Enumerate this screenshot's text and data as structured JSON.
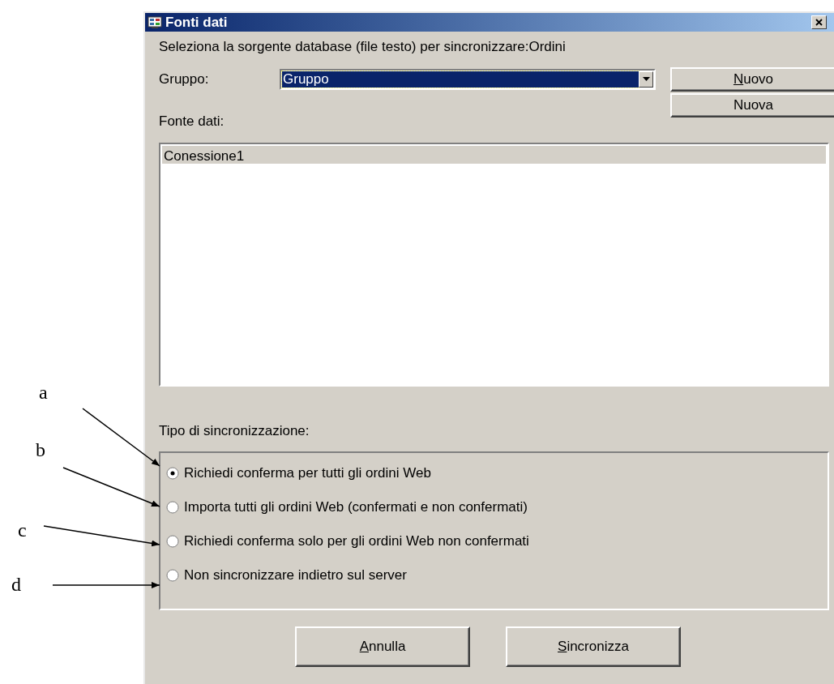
{
  "window": {
    "title": "Fonti dati"
  },
  "prompt": "Seleziona la sorgente database (file testo) per sincronizzare:Ordini",
  "group": {
    "label": "Gruppo:",
    "value": "Gruppo"
  },
  "buttons_top": [
    {
      "label": "Nuovo",
      "underline_first": true
    },
    {
      "label": "Nuova",
      "underline_first": false
    }
  ],
  "source": {
    "label": "Fonte dati:",
    "items": [
      {
        "text": "Conessione1",
        "selected": true
      }
    ]
  },
  "sync": {
    "label": "Tipo di sincronizzazione:",
    "options": [
      {
        "text": "Richiedi conferma per tutti gli ordini Web",
        "selected": true
      },
      {
        "text": "Importa tutti gli ordini Web (confermati e non confermati)",
        "selected": false
      },
      {
        "text": "Richiedi conferma solo per gli ordini Web non confermati",
        "selected": false
      },
      {
        "text": "Non sincronizzare indietro sul server",
        "selected": false
      }
    ]
  },
  "buttons_bottom": [
    {
      "label": "Annulla",
      "underline_first": true
    },
    {
      "label": "Sincronizza",
      "underline_first": true
    }
  ],
  "annotations": [
    {
      "label": "a"
    },
    {
      "label": "b"
    },
    {
      "label": "c"
    },
    {
      "label": "d"
    }
  ]
}
